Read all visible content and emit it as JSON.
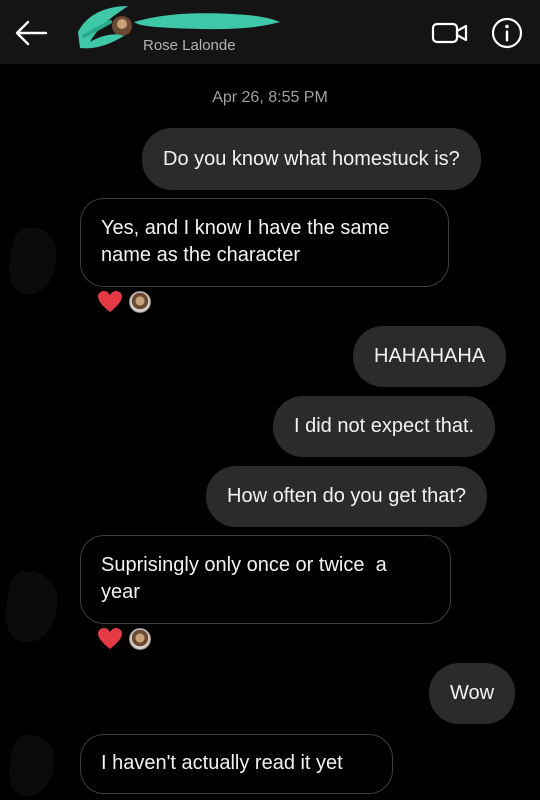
{
  "header": {
    "username": "Rose Lalonde",
    "back_icon": "arrow-left-icon",
    "video_icon": "video-camera-icon",
    "info_icon": "info-icon"
  },
  "timestamp": "Apr 26, 8:55 PM",
  "messages": [
    {
      "direction": "sent",
      "text": "Do you know what homestuck is?"
    },
    {
      "direction": "received",
      "lines": [
        "Yes, and I know I have the same",
        "name as the character"
      ],
      "reactions": [
        "heart-icon",
        "avatar"
      ]
    },
    {
      "direction": "sent",
      "text": "HAHAHAHA"
    },
    {
      "direction": "sent",
      "text": "I did not expect that."
    },
    {
      "direction": "sent",
      "text": "How often do you get that?"
    },
    {
      "direction": "received",
      "lines": [
        "Suprisingly only once or twice  a",
        "year"
      ],
      "reactions": [
        "heart-icon",
        "avatar"
      ]
    },
    {
      "direction": "sent",
      "text": "Wow"
    },
    {
      "direction": "received",
      "lines": [
        "I haven't actually read it yet"
      ]
    }
  ],
  "colors": {
    "background": "#000000",
    "header": "#141414",
    "sent_bubble": "#2b2b2b",
    "received_border": "#3d3d3d",
    "heart": "#e53945",
    "redaction": "#3fc8a8"
  }
}
